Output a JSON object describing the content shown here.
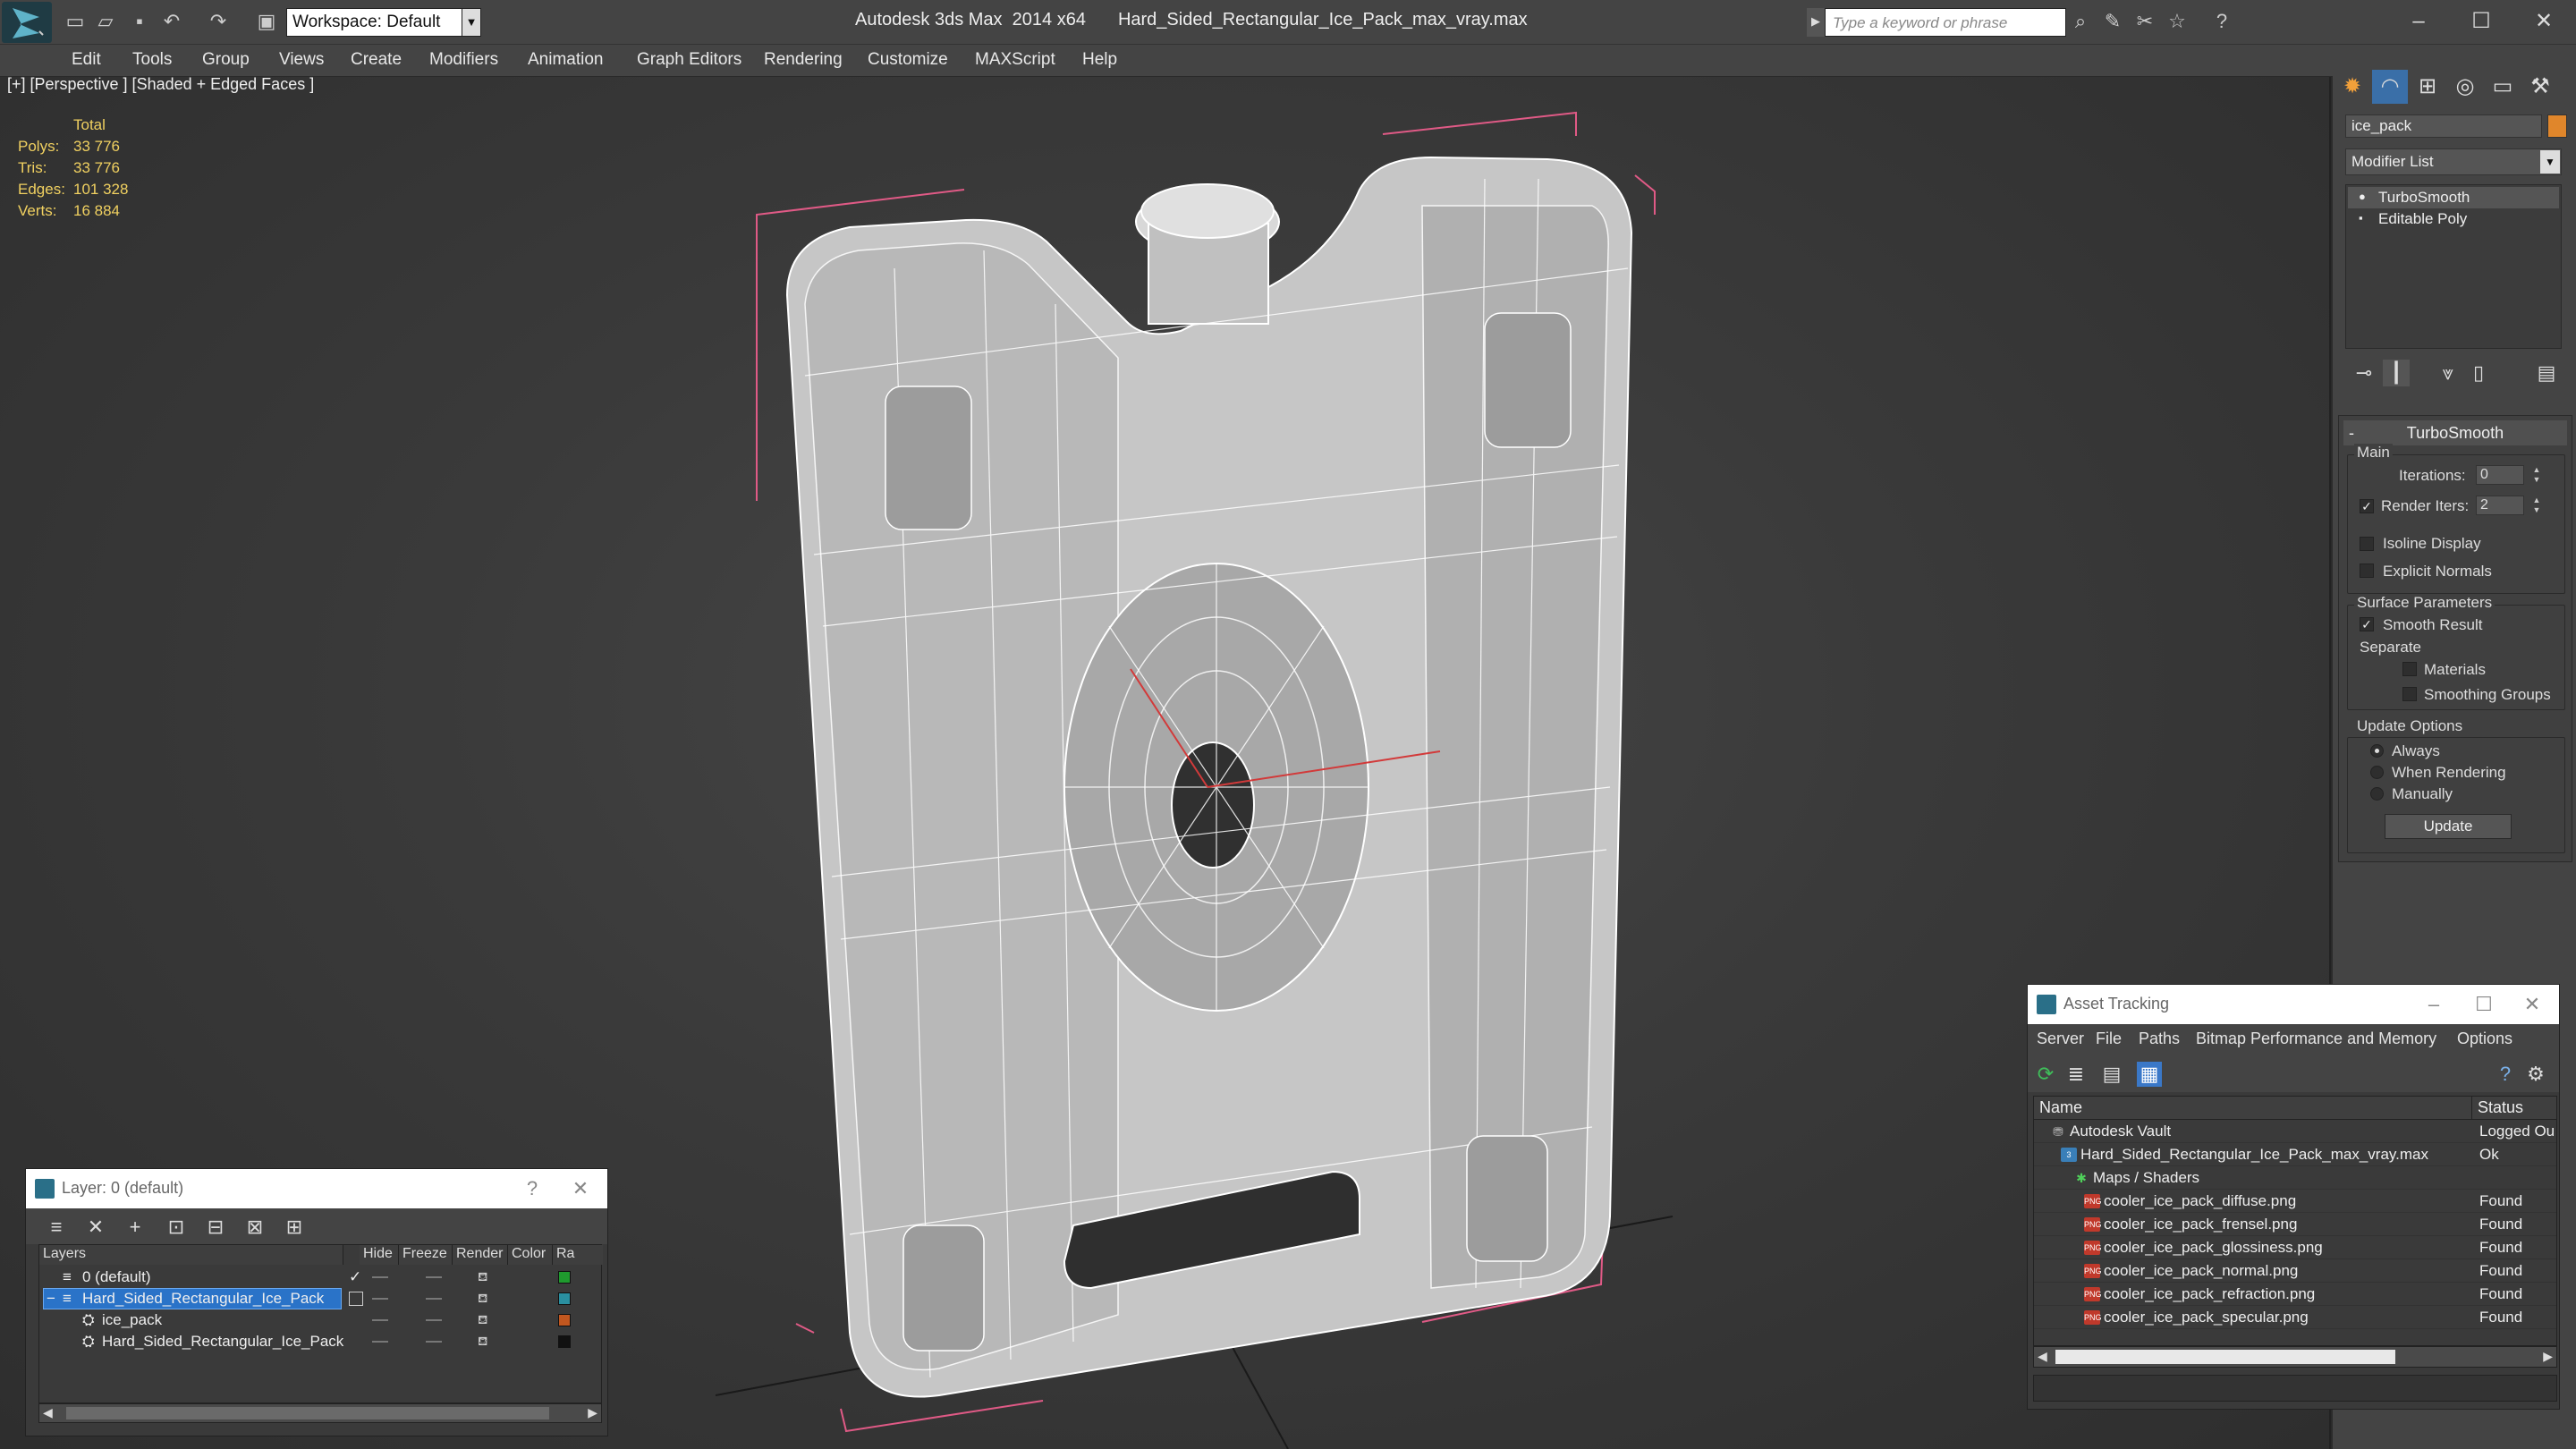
{
  "titlebar": {
    "app_name": "Autodesk 3ds Max  2014 x64",
    "file_name": "Hard_Sided_Rectangular_Ice_Pack_max_vray.max",
    "workspace": "Workspace: Default",
    "search_placeholder": "Type a keyword or phrase"
  },
  "menubar": {
    "items": [
      "Edit",
      "Tools",
      "Group",
      "Views",
      "Create",
      "Modifiers",
      "Animation",
      "Graph Editors",
      "Rendering",
      "Customize",
      "MAXScript",
      "Help"
    ]
  },
  "viewport": {
    "label": "[+] [Perspective ] [Shaded + Edged Faces ]",
    "stats": {
      "header": "Total",
      "rows": [
        {
          "label": "Polys:",
          "value": "33 776"
        },
        {
          "label": "Tris:",
          "value": "33 776"
        },
        {
          "label": "Edges:",
          "value": "101 328"
        },
        {
          "label": "Verts:",
          "value": "16 884"
        }
      ]
    }
  },
  "command_panel": {
    "object_name": "ice_pack",
    "object_color": "#e0862b",
    "modifier_list": "Modifier List",
    "stack": [
      "TurboSmooth",
      "Editable Poly"
    ],
    "rollout": {
      "title": "TurboSmooth",
      "main_group": "Main",
      "iterations_label": "Iterations:",
      "iterations_value": "0",
      "render_iters_label": "Render Iters:",
      "render_iters_value": "2",
      "render_iters_checked": true,
      "isoline_label": "Isoline Display",
      "isoline_checked": false,
      "explicit_normals_label": "Explicit Normals",
      "explicit_normals_checked": false,
      "surface_group": "Surface Parameters",
      "smooth_result_label": "Smooth Result",
      "smooth_result_checked": true,
      "separate_label": "Separate",
      "materials_label": "Materials",
      "smoothing_groups_label": "Smoothing Groups",
      "update_group": "Update Options",
      "opt_always": "Always",
      "opt_rendering": "When Rendering",
      "opt_manually": "Manually",
      "update_button": "Update"
    }
  },
  "layer_window": {
    "title": "Layer: 0 (default)",
    "help_glyph": "?",
    "columns": [
      "Layers",
      "Hide",
      "Freeze",
      "Render",
      "Color",
      "Ra"
    ],
    "rows": [
      {
        "name": "0 (default)",
        "color": "#1f9a2e",
        "active": true
      },
      {
        "name": "Hard_Sided_Rectangular_Ice_Pack",
        "color": "#2a8fa0",
        "selected": true
      },
      {
        "name": "ice_pack",
        "color": "#c2571f"
      },
      {
        "name": "Hard_Sided_Rectangular_Ice_Pack",
        "color": "#111111"
      }
    ]
  },
  "asset_window": {
    "title": "Asset Tracking",
    "menu": [
      "Server",
      "File",
      "Paths",
      "Bitmap Performance and Memory",
      "Options"
    ],
    "columns": [
      "Name",
      "Status"
    ],
    "rows": [
      {
        "name": "Autodesk Vault",
        "status": "Logged Ou"
      },
      {
        "name": "Hard_Sided_Rectangular_Ice_Pack_max_vray.max",
        "status": "Ok"
      },
      {
        "name": "Maps / Shaders",
        "status": ""
      },
      {
        "name": "cooler_ice_pack_diffuse.png",
        "status": "Found"
      },
      {
        "name": "cooler_ice_pack_frensel.png",
        "status": "Found"
      },
      {
        "name": "cooler_ice_pack_glossiness.png",
        "status": "Found"
      },
      {
        "name": "cooler_ice_pack_normal.png",
        "status": "Found"
      },
      {
        "name": "cooler_ice_pack_refraction.png",
        "status": "Found"
      },
      {
        "name": "cooler_ice_pack_specular.png",
        "status": "Found"
      }
    ]
  }
}
